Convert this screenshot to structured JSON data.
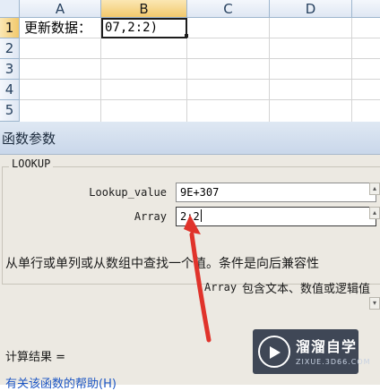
{
  "sheet": {
    "columns": [
      "A",
      "B",
      "C",
      "D"
    ],
    "rows": [
      "1",
      "2",
      "3",
      "4",
      "5"
    ],
    "a1_text": "更新数据：",
    "b1_formula": "07,2:2)"
  },
  "dialog": {
    "title": "函数参数",
    "function_name": "LOOKUP",
    "args": [
      {
        "label": "Lookup_value",
        "value": "9E+307"
      },
      {
        "label": "Array",
        "value": "2:2"
      }
    ],
    "description": "从单行或单列或从数组中查找一个值。条件是向后兼容性",
    "arg_desc_name": "Array",
    "arg_desc_text": "包含文本、数值或逻辑值",
    "result_label": "计算结果 =",
    "help_link": "有关该函数的帮助(H)"
  },
  "watermark": {
    "name": "溜溜自学",
    "url": "ZIXUE.3D66.COM"
  },
  "colors": {
    "header_selected": "#f2c96c",
    "arrow": "#e0332b",
    "link": "#1d56c4"
  }
}
